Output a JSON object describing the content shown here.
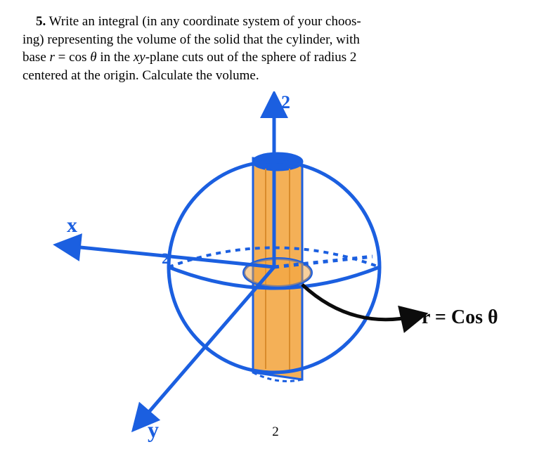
{
  "problem": {
    "number": "5.",
    "text_parts": {
      "p1": "Write an integral (in any coordinate system of your choos-",
      "p2": "ing) representing the volume of the solid that the cylinder, with",
      "p3_a": "base ",
      "p3_r": "r",
      "p3_eq": " = cos ",
      "p3_theta": "θ",
      "p3_b": " in the ",
      "p3_xy": "xy",
      "p3_c": "-plane cuts out of the sphere of radius 2",
      "p4": "centered at the origin. Calculate the volume."
    }
  },
  "figure": {
    "axis_x": "x",
    "axis_y": "y",
    "z_top": "2",
    "x_tick": "2",
    "annotation": "r = Cos θ",
    "colors": {
      "ink": "#1b5fe0",
      "orange": "#f2a23a",
      "dark": "#0c0c0c"
    }
  },
  "page_number": "2"
}
